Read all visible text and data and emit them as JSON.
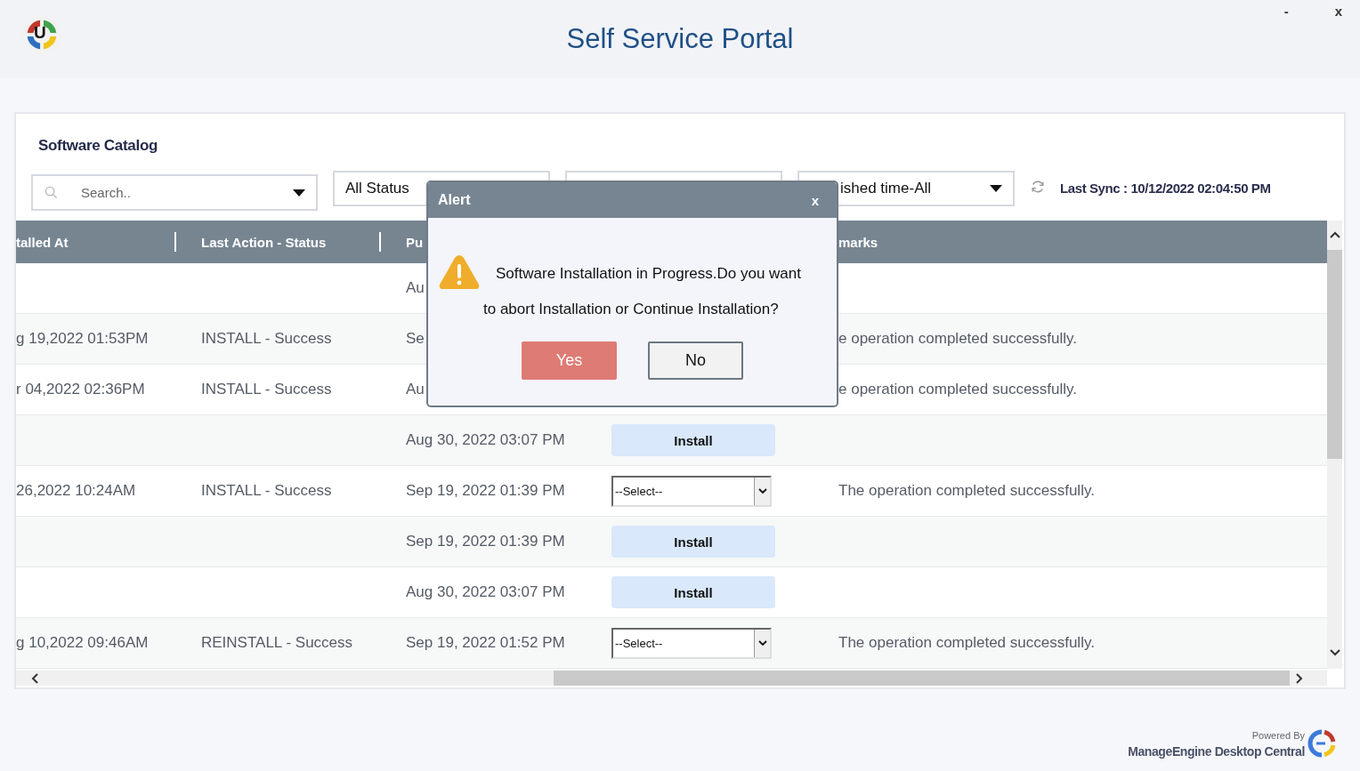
{
  "window": {
    "title": "Self Service Portal",
    "logo_letter": "U",
    "controls": [
      "-",
      "x"
    ]
  },
  "catalog": {
    "title": "Software Catalog",
    "search": {
      "placeholder": "Search.."
    },
    "filters": [
      {
        "kind": "dropdown",
        "value": "All Status"
      },
      {
        "kind": "dropdown"
      },
      {
        "kind": "dropdown",
        "value": "ished time-All",
        "caret": true
      }
    ],
    "last_sync": "Last Sync : 10/12/2022 02:04:50 PM"
  },
  "table": {
    "columns": [
      {
        "label": "talled At"
      },
      {
        "label": "Last Action - Status"
      },
      {
        "label": "Pu"
      },
      {},
      {
        "label": "marks"
      }
    ],
    "rows": [
      {
        "published": "Au"
      },
      {
        "installed": "g 19,2022 01:53PM",
        "status": "INSTALL - Success",
        "published": "Se",
        "remarks": "e operation completed successfully."
      },
      {
        "installed": "r 04,2022 02:36PM",
        "status": "INSTALL - Success",
        "published": "Au",
        "remarks": "e operation completed successfully."
      },
      {
        "published": "Aug 30, 2022 03:07 PM",
        "action": {
          "kind": "install",
          "label": "Install"
        }
      },
      {
        "installed": "26,2022 10:24AM",
        "status": "INSTALL - Success",
        "published": "Sep 19, 2022 01:39 PM",
        "action": {
          "kind": "select",
          "value": "--Select--"
        },
        "remarks": "The operation completed successfully."
      },
      {
        "published": "Sep 19, 2022 01:39 PM",
        "action": {
          "kind": "install",
          "label": "Install"
        }
      },
      {
        "published": "Aug 30, 2022 03:07 PM",
        "action": {
          "kind": "install",
          "label": "Install"
        }
      },
      {
        "installed": "g 10,2022 09:46AM",
        "status": "REINSTALL - Success",
        "published": "Sep 19, 2022 01:52 PM",
        "action": {
          "kind": "select",
          "value": "--Select--"
        },
        "remarks": "The operation completed successfully."
      }
    ]
  },
  "dialog": {
    "title": "Alert",
    "close": "x",
    "message": [
      "Software Installation in Progress.Do you want",
      "to abort Installation or Continue Installation?"
    ],
    "buttons": [
      {
        "label": "Yes",
        "kind": "primary"
      },
      {
        "label": "No",
        "kind": "secondary"
      }
    ]
  },
  "footer": {
    "powered_by": "Powered By",
    "product": "ManageEngine Desktop Central"
  }
}
